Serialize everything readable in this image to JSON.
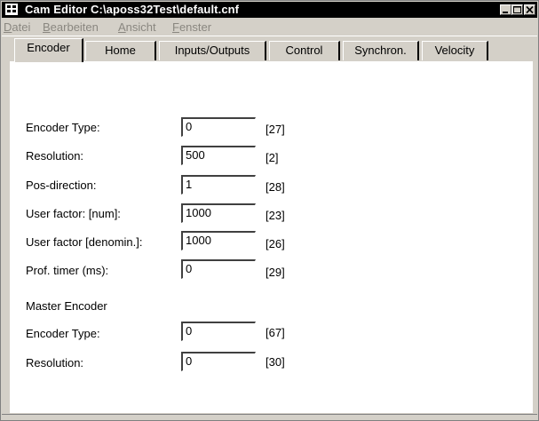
{
  "window": {
    "title": "Cam Editor C:\\aposs32Test\\default.cnf",
    "controls": [
      "minimize-icon",
      "maximize-icon",
      "close-icon"
    ]
  },
  "menu": {
    "items": [
      {
        "label": "Datei",
        "u": "D",
        "rest": "atei"
      },
      {
        "label": "Bearbeiten",
        "u": "B",
        "rest": "earbeiten"
      },
      {
        "label": "Ansicht",
        "u": "A",
        "rest": "nsicht"
      },
      {
        "label": "Fenster",
        "u": "F",
        "rest": "enster"
      }
    ]
  },
  "tabs": [
    {
      "label": "Encoder",
      "active": true
    },
    {
      "label": "Home"
    },
    {
      "label": "Inputs/Outputs"
    },
    {
      "label": "Control"
    },
    {
      "label": "Synchron."
    },
    {
      "label": "Velocity"
    }
  ],
  "encoder": {
    "rows": [
      {
        "label": "Encoder Type:",
        "value": "0",
        "code": "[27]"
      },
      {
        "label": "Resolution:",
        "value": "500",
        "code": "[2]"
      },
      {
        "label": "Pos-direction:",
        "value": "1",
        "code": "[28]"
      },
      {
        "label": "User factor: [num]:",
        "value": "1000",
        "code": "[23]"
      },
      {
        "label": "User factor [denomin.]:",
        "value": "1000",
        "code": "[26]"
      },
      {
        "label": "Prof. timer (ms):",
        "value": "0",
        "code": "[29]"
      }
    ],
    "master_heading": "Master Encoder",
    "master_rows": [
      {
        "label": "Encoder Type:",
        "value": "0",
        "code": "[67]"
      },
      {
        "label": "Resolution:",
        "value": "0",
        "code": "[30]"
      }
    ]
  }
}
